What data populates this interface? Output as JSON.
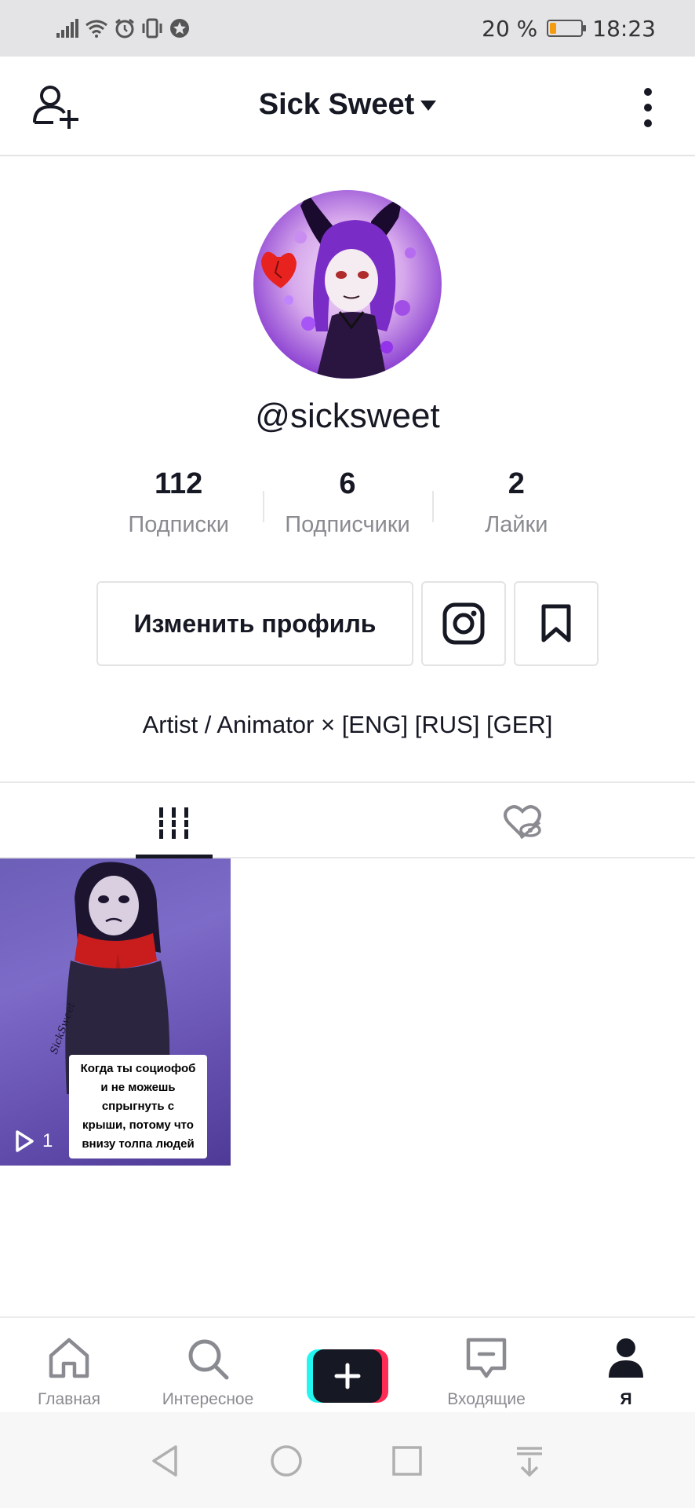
{
  "status_bar": {
    "battery_text": "20 %",
    "time": "18:23",
    "battery_level": 0.2,
    "battery_color": "#f39c12"
  },
  "header": {
    "account_name": "Sick Sweet",
    "add_friend_icon": "person-plus-icon",
    "more_icon": "vertical-dots-icon"
  },
  "profile": {
    "username": "@sicksweet",
    "stats": [
      {
        "value": "112",
        "label": "Подписки"
      },
      {
        "value": "6",
        "label": "Подписчики"
      },
      {
        "value": "2",
        "label": "Лайки"
      }
    ],
    "edit_button": "Изменить профиль",
    "instagram_icon": "instagram-icon",
    "bookmark_icon": "bookmark-icon",
    "bio": "Artist / Animator × [ENG] [RUS] [GER]"
  },
  "tabs": {
    "videos_icon": "grid-bars-icon",
    "liked_icon": "hidden-heart-icon"
  },
  "videos": [
    {
      "caption_lines": [
        "Когда ты социофоб",
        "и не можешь",
        "спрыгнуть с",
        "крыши, потому что",
        "внизу толпа людей"
      ],
      "views": "1",
      "watermark": "SickSweet"
    }
  ],
  "bottom_nav": [
    {
      "label": "Главная",
      "icon": "home-icon"
    },
    {
      "label": "Интересное",
      "icon": "search-icon"
    },
    {
      "label": "",
      "icon": "plus-icon"
    },
    {
      "label": "Входящие",
      "icon": "inbox-icon"
    },
    {
      "label": "Я",
      "icon": "profile-icon"
    }
  ],
  "colors": {
    "text_primary": "#161823",
    "text_secondary": "#8a8b91",
    "accent_cyan": "#24f6f0",
    "accent_pink": "#fe2c55"
  }
}
